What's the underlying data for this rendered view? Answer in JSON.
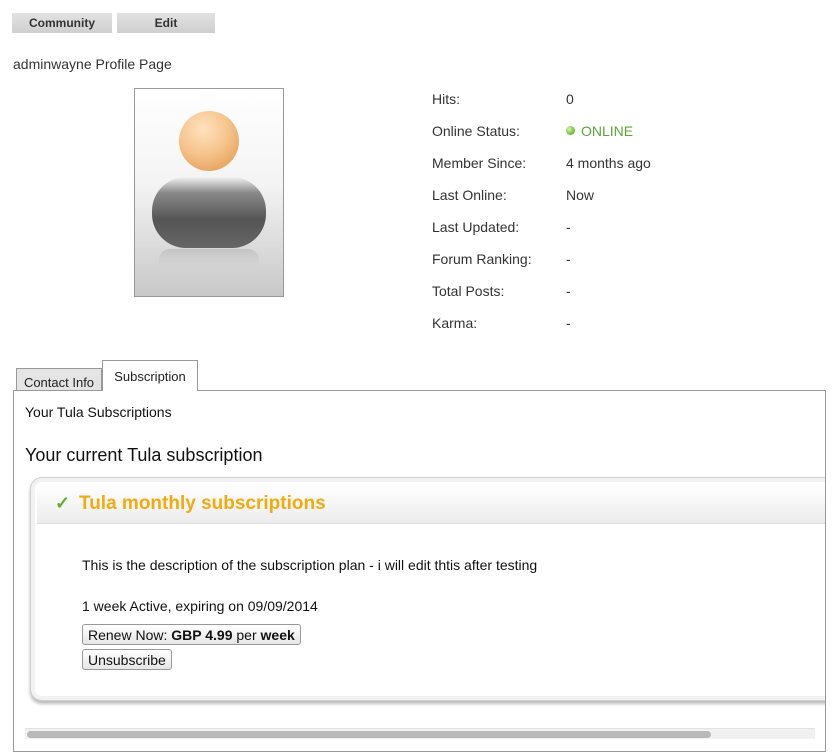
{
  "toolbar": {
    "community_label": "Community",
    "edit_label": "Edit"
  },
  "profile": {
    "title": "adminwayne Profile Page",
    "avatar_icon": "default-user-avatar-icon"
  },
  "stats": [
    {
      "label": "Hits:",
      "value": "0"
    },
    {
      "label": "Online Status:",
      "value": "ONLINE"
    },
    {
      "label": "Member Since:",
      "value": "4 months ago"
    },
    {
      "label": "Last Online:",
      "value": "Now"
    },
    {
      "label": "Last Updated:",
      "value": "-"
    },
    {
      "label": "Forum Ranking:",
      "value": "-"
    },
    {
      "label": "Total Posts:",
      "value": "-"
    },
    {
      "label": "Karma:",
      "value": "-"
    }
  ],
  "tabs": [
    {
      "label": "Contact Info",
      "active": false
    },
    {
      "label": "Subscription",
      "active": true
    }
  ],
  "subscription": {
    "section_label": "Your Tula Subscriptions",
    "heading": "Your current Tula subscription",
    "plan": {
      "name": "Tula monthly subscriptions",
      "description": "This is the description of the subscription plan - i will edit thtis after testing",
      "status": "1 week Active, expiring on 09/09/2014",
      "renew": {
        "prefix": "Renew Now:",
        "price": "GBP 4.99",
        "per": "per",
        "period": "week"
      },
      "unsubscribe_label": "Unsubscribe"
    }
  },
  "colors": {
    "online": "#5aa53a",
    "plan_title": "#f0ab10",
    "check": "#6aa82f"
  }
}
